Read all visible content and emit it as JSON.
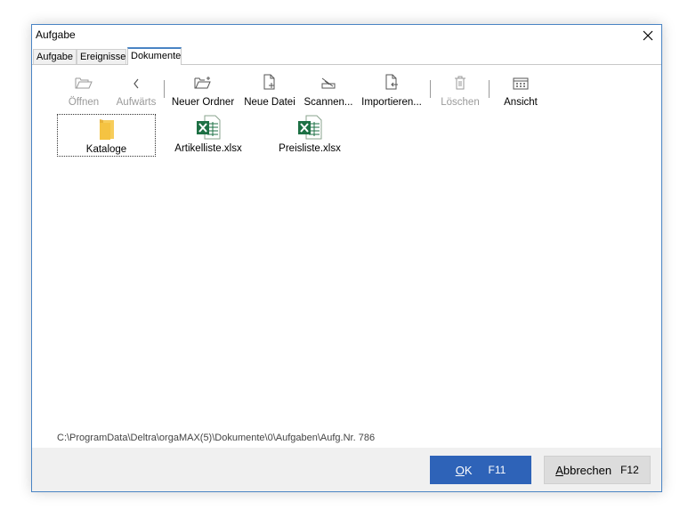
{
  "window": {
    "title": "Aufgabe"
  },
  "tabs": [
    {
      "label": "Aufgabe",
      "active": false
    },
    {
      "label": "Ereignisse",
      "active": false
    },
    {
      "label": "Dokumente",
      "active": true
    }
  ],
  "toolbar": {
    "open": {
      "label": "Öffnen",
      "icon": "folder-open-icon",
      "enabled": false
    },
    "up": {
      "label": "Aufwärts",
      "icon": "chevron-left-icon",
      "enabled": false
    },
    "new_folder": {
      "label": "Neuer Ordner",
      "icon": "new-folder-icon",
      "enabled": true
    },
    "new_file": {
      "label": "Neue Datei",
      "icon": "new-file-icon",
      "enabled": true
    },
    "scan": {
      "label": "Scannen...",
      "icon": "scanner-icon",
      "enabled": true
    },
    "import": {
      "label": "Importieren...",
      "icon": "import-icon",
      "enabled": true
    },
    "delete": {
      "label": "Löschen",
      "icon": "trash-icon",
      "enabled": false
    },
    "view": {
      "label": "Ansicht",
      "icon": "grid-view-icon",
      "enabled": true
    }
  },
  "files": [
    {
      "name": "Kataloge",
      "type": "folder",
      "selected": true
    },
    {
      "name": "Artikelliste.xlsx",
      "type": "excel",
      "selected": false
    },
    {
      "name": "Preisliste.xlsx",
      "type": "excel",
      "selected": false
    }
  ],
  "path": "C:\\ProgramData\\Deltra\\orgaMAX(5)\\Dokumente\\0\\Aufgaben\\Aufg.Nr. 786",
  "buttons": {
    "ok": {
      "label_first": "O",
      "label_rest": "K",
      "key": "F11"
    },
    "cancel": {
      "label_first": "A",
      "label_rest": "bbrechen",
      "key": "F12"
    }
  },
  "colors": {
    "accent": "#2e63b8",
    "excel": "#1d7044",
    "folder": "#f5c342",
    "disabled": "#9a9a9a"
  }
}
